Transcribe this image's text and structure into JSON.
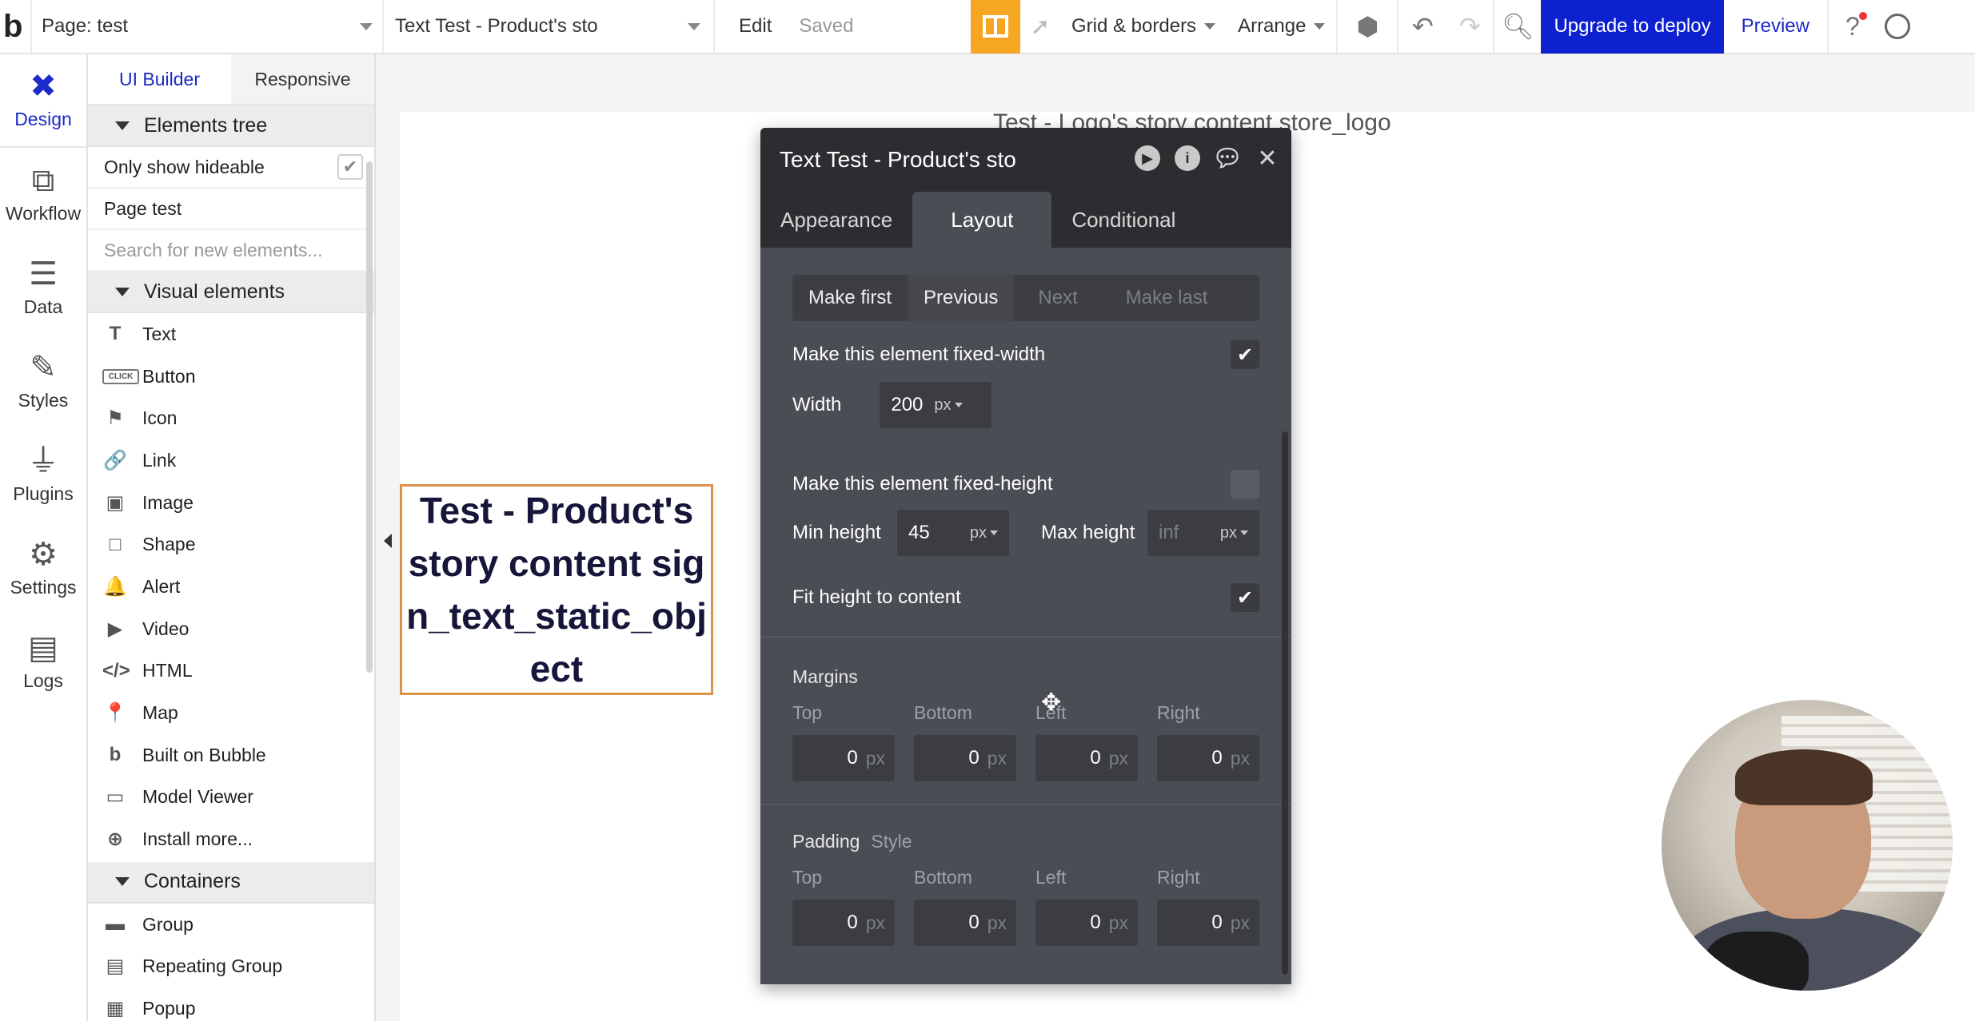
{
  "topbar": {
    "logo": "b",
    "page_label": "Page: test",
    "element_label": "Text Test - Product's sto",
    "edit_label": "Edit",
    "saved_label": "Saved",
    "grid_label": "Grid & borders",
    "arrange_label": "Arrange",
    "upgrade_label": "Upgrade to deploy",
    "preview_label": "Preview"
  },
  "leftnav": {
    "items": [
      {
        "label": "Design",
        "icon": "design-icon"
      },
      {
        "label": "Workflow",
        "icon": "workflow-icon"
      },
      {
        "label": "Data",
        "icon": "database-icon"
      },
      {
        "label": "Styles",
        "icon": "brush-icon"
      },
      {
        "label": "Plugins",
        "icon": "plug-icon"
      },
      {
        "label": "Settings",
        "icon": "gear-icon"
      },
      {
        "label": "Logs",
        "icon": "document-icon"
      }
    ]
  },
  "panel": {
    "tabs": [
      "UI Builder",
      "Responsive"
    ],
    "elements_tree": "Elements tree",
    "only_hideable": "Only show hideable",
    "page_item": "Page test",
    "search_placeholder": "Search for new elements...",
    "visual_elements": "Visual elements",
    "visual_items": [
      {
        "label": "Text",
        "icon": "T"
      },
      {
        "label": "Button",
        "icon": "CLICK"
      },
      {
        "label": "Icon",
        "icon": "⚑"
      },
      {
        "label": "Link",
        "icon": "🔗"
      },
      {
        "label": "Image",
        "icon": "▣"
      },
      {
        "label": "Shape",
        "icon": "□"
      },
      {
        "label": "Alert",
        "icon": "🔔"
      },
      {
        "label": "Video",
        "icon": "▶"
      },
      {
        "label": "HTML",
        "icon": "</>"
      },
      {
        "label": "Map",
        "icon": "📍"
      },
      {
        "label": "Built on Bubble",
        "icon": "b"
      },
      {
        "label": "Model Viewer",
        "icon": "▭"
      },
      {
        "label": "Install more...",
        "icon": "⊕"
      }
    ],
    "containers": "Containers",
    "container_items": [
      {
        "label": "Group",
        "icon": "▬"
      },
      {
        "label": "Repeating Group",
        "icon": "▤"
      },
      {
        "label": "Popup",
        "icon": "▦"
      }
    ]
  },
  "canvas": {
    "heading": "Test - Logo's story content store_logo",
    "text_box": "Test - Product's story content sign_text_static_object"
  },
  "editor": {
    "title": "Text Test - Product's sto",
    "tabs": [
      "Appearance",
      "Layout",
      "Conditional"
    ],
    "order": [
      "Make first",
      "Previous",
      "Next",
      "Make last"
    ],
    "fixed_width_label": "Make this element fixed-width",
    "width_label": "Width",
    "width_value": "200",
    "unit_px": "px",
    "fixed_height_label": "Make this element fixed-height",
    "min_height_label": "Min height",
    "min_height_value": "45",
    "max_height_label": "Max height",
    "max_height_placeholder": "inf",
    "fit_height_label": "Fit height to content",
    "margins_label": "Margins",
    "padding_label": "Padding",
    "style_label": "Style",
    "sides": [
      "Top",
      "Bottom",
      "Left",
      "Right"
    ],
    "zero": "0"
  }
}
